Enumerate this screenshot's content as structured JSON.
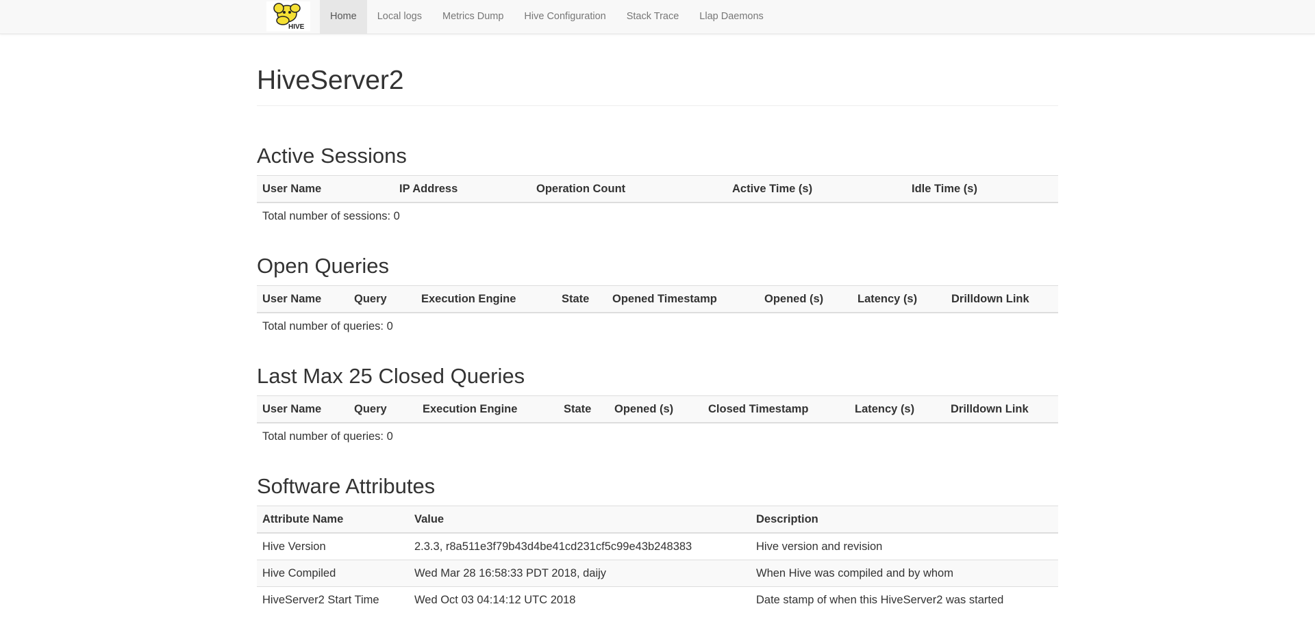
{
  "nav": {
    "items": [
      {
        "label": "Home",
        "active": true
      },
      {
        "label": "Local logs"
      },
      {
        "label": "Metrics Dump"
      },
      {
        "label": "Hive Configuration"
      },
      {
        "label": "Stack Trace"
      },
      {
        "label": "Llap Daemons"
      }
    ],
    "logo_text": "HIVE"
  },
  "page": {
    "title": "HiveServer2"
  },
  "active_sessions": {
    "title": "Active Sessions",
    "columns": [
      "User Name",
      "IP Address",
      "Operation Count",
      "Active Time (s)",
      "Idle Time (s)"
    ],
    "footer": "Total number of sessions: 0"
  },
  "open_queries": {
    "title": "Open Queries",
    "columns": [
      "User Name",
      "Query",
      "Execution Engine",
      "State",
      "Opened Timestamp",
      "Opened (s)",
      "Latency (s)",
      "Drilldown Link"
    ],
    "footer": "Total number of queries: 0"
  },
  "closed_queries": {
    "title": "Last Max 25 Closed Queries",
    "columns": [
      "User Name",
      "Query",
      "Execution Engine",
      "State",
      "Opened (s)",
      "Closed Timestamp",
      "Latency (s)",
      "Drilldown Link"
    ],
    "footer": "Total number of queries: 0"
  },
  "software_attributes": {
    "title": "Software Attributes",
    "columns": [
      "Attribute Name",
      "Value",
      "Description"
    ],
    "rows": [
      [
        "Hive Version",
        "2.3.3, r8a511e3f79b43d4be41cd231cf5c99e43b248383",
        "Hive version and revision"
      ],
      [
        "Hive Compiled",
        "Wed Mar 28 16:58:33 PDT 2018, daijy",
        "When Hive was compiled and by whom"
      ],
      [
        "HiveServer2 Start Time",
        "Wed Oct 03 04:14:12 UTC 2018",
        "Date stamp of when this HiveServer2 was started"
      ]
    ]
  }
}
